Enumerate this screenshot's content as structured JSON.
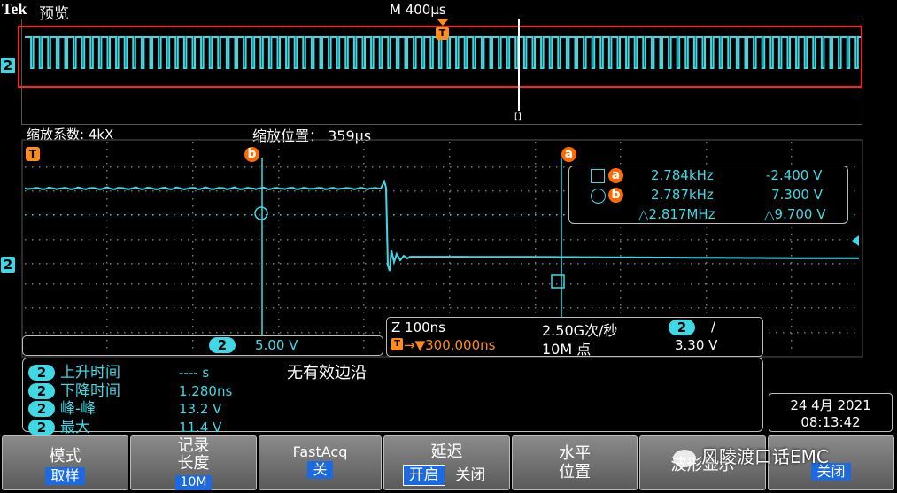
{
  "header": {
    "brand": "Tek",
    "mode": "预览",
    "timebase": "M 400µs"
  },
  "channel": {
    "number": "2"
  },
  "zoom": {
    "factor": "缩放系数: 4kX",
    "position": "缩放位置： 359µs"
  },
  "markers": {
    "trigger": "T",
    "cursor_a": "a",
    "cursor_b": "b"
  },
  "cursor_readout": {
    "a": {
      "freq": "2.784kHz",
      "volt": "-2.400 V"
    },
    "b": {
      "freq": "2.787kHz",
      "volt": "7.300 V"
    },
    "delta": {
      "freq": "△2.817MHz",
      "volt": "△9.700 V"
    }
  },
  "channel_scale": {
    "channel": "2",
    "scale": "5.00 V"
  },
  "horizontal_info": {
    "zoom_scale": "Z 100ns",
    "sample_rate": "2.50G次/秒",
    "delay": "→▼300.000ns",
    "record": "10M 点",
    "trig_channel": "2",
    "trig_slope": "/",
    "trig_level": "3.30 V"
  },
  "measurements": [
    {
      "ch": "2",
      "label": "上升时间",
      "value": "---- s"
    },
    {
      "ch": "2",
      "label": "下降时间",
      "value": "1.280ns"
    },
    {
      "ch": "2",
      "label": "峰-峰",
      "value": "13.2 V"
    },
    {
      "ch": "2",
      "label": "最大",
      "value": "11.4 V"
    }
  ],
  "no_edge": "无有效边沿",
  "datetime": {
    "date": "24 4月 2021",
    "time": "08:13:42"
  },
  "softkeys": {
    "mode": {
      "label": "模式",
      "value": "取样"
    },
    "record": {
      "label1": "记录",
      "label2": "长度",
      "value": "10M"
    },
    "fastacq": {
      "label": "FastAcq",
      "value": "关"
    },
    "delay": {
      "label": "延迟",
      "on": "开启",
      "off": "关闭"
    },
    "horizontal": {
      "label1": "水平",
      "label2": "位置"
    },
    "waveform": {
      "label": "波形显示"
    },
    "last": {
      "value": "关闭"
    }
  },
  "watermark": "风陵渡口话EMC",
  "colors": {
    "trace": "#3fd9e6",
    "accent": "#ff6a00",
    "highlight": "#ff2020"
  }
}
